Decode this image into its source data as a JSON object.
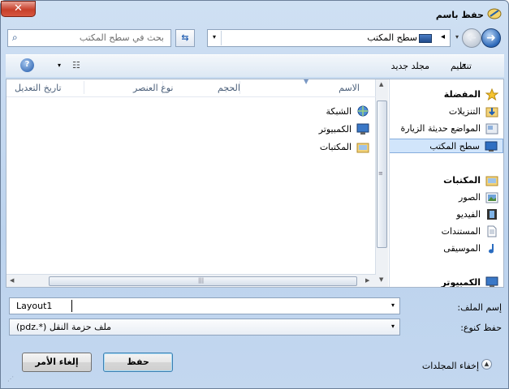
{
  "window": {
    "title": "حفظ باسم",
    "close_label": "✕"
  },
  "nav": {
    "back_glyph": "➜",
    "fwd_glyph": "➜"
  },
  "address": {
    "location": "سطح المكتب",
    "separator": "◂",
    "dropdown": "▾"
  },
  "search": {
    "placeholder": "بحث في سطح المكتب",
    "icon_glyph": "⌕"
  },
  "toolbar": {
    "organize_label": "تنظيم",
    "new_folder_label": "مجلد جديد",
    "dropdown": "▾",
    "views_glyph": "☷",
    "help_glyph": "?"
  },
  "sidebar": {
    "items": [
      {
        "label": "المفضلة",
        "icon": "star-icon"
      },
      {
        "label": "التنزيلات",
        "icon": "downloads-folder-icon"
      },
      {
        "label": "المواضع حديثة الزيارة",
        "icon": "recent-places-icon"
      },
      {
        "label": "سطح المكتب",
        "icon": "desktop-icon",
        "selected": true
      },
      {
        "label": "المكتبات",
        "icon": "libraries-folder-icon"
      },
      {
        "label": "الصور",
        "icon": "pictures-icon"
      },
      {
        "label": "الفيديو",
        "icon": "video-icon"
      },
      {
        "label": "المستندات",
        "icon": "documents-icon"
      },
      {
        "label": "الموسيقى",
        "icon": "music-icon"
      },
      {
        "label": "الكمبيوتر",
        "icon": "computer-icon"
      }
    ]
  },
  "files": {
    "columns": [
      "الاسم",
      "الحجم",
      "نوع العنصر",
      "تاريخ التعديل"
    ],
    "items": [
      {
        "name": "الشبكة",
        "icon": "network-icon"
      },
      {
        "name": "الكمبيوتر",
        "icon": "computer-icon"
      },
      {
        "name": "المكتبات",
        "icon": "libraries-folder-icon"
      }
    ]
  },
  "scroll": {
    "up": "▲",
    "down": "▼",
    "left": "◀",
    "right": "▶",
    "grip": "≡",
    "hgrip": "|||"
  },
  "form": {
    "filename_label": "إسم الملف:",
    "filename_value": "Layout1",
    "type_label": "حفظ كنوع:",
    "type_value": "ملف حزمة النقل (*.pdz)",
    "dropdown": "▾"
  },
  "buttons": {
    "save": "حفظ",
    "cancel": "إلغاء الأمر"
  },
  "footer": {
    "hide_folders": "إخفاء المجلدات",
    "hide_glyph": "▲",
    "grip": "⋰"
  }
}
